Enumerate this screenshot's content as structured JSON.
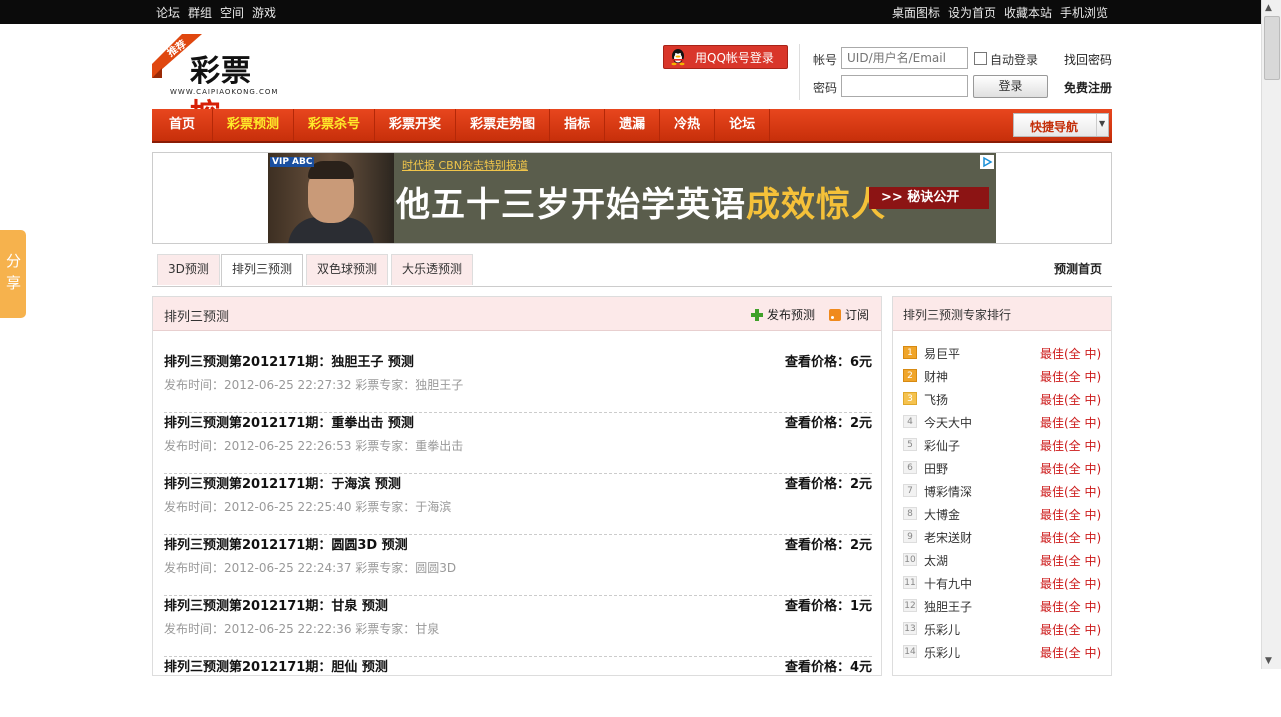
{
  "topbar": {
    "left": [
      "论坛",
      "群组",
      "空间",
      "游戏"
    ],
    "right": [
      "桌面图标",
      "设为首页",
      "收藏本站",
      "手机浏览"
    ]
  },
  "share": {
    "label": "分享"
  },
  "logo": {
    "tag": "推荐",
    "name1": "彩票",
    "name2": "控",
    "site": "WWW.CAIPIAOKONG.COM"
  },
  "login": {
    "qq_button": "用QQ帐号登录",
    "account_label": "帐号",
    "account_placeholder": "UID/用户名/Email",
    "auto_login": "自动登录",
    "find_password": "找回密码",
    "password_label": "密码",
    "login_button": "登录",
    "register": "免费注册"
  },
  "nav": {
    "items": [
      "首页",
      "彩票预测",
      "彩票杀号",
      "彩票开奖",
      "彩票走势图",
      "指标",
      "遗漏",
      "冷热",
      "论坛"
    ],
    "quick_nav": "快捷导航"
  },
  "ad": {
    "vip": "VIP ABC",
    "subtitle": "时代报 CBN杂志特别报道",
    "headline_a": "他五十三岁开始学英语",
    "headline_b": "成效惊人",
    "cta": ">> 秘诀公开"
  },
  "tabs": {
    "items": [
      "3D预测",
      "排列三预测",
      "双色球预测",
      "大乐透预测"
    ],
    "active": "排列三预测",
    "home": "预测首页"
  },
  "panel": {
    "title": "排列三预测",
    "publish": "发布预测",
    "subscribe": "订阅",
    "rows": [
      {
        "title": "排列三预测第2012171期：独胆王子 预测",
        "price": "查看价格：6元",
        "meta": "发布时间：2012-06-25 22:27:32 彩票专家：独胆王子"
      },
      {
        "title": "排列三预测第2012171期：重拳出击 预测",
        "price": "查看价格：2元",
        "meta": "发布时间：2012-06-25 22:26:53 彩票专家：重拳出击"
      },
      {
        "title": "排列三预测第2012171期：于海滨 预测",
        "price": "查看价格：2元",
        "meta": "发布时间：2012-06-25 22:25:40 彩票专家：于海滨"
      },
      {
        "title": "排列三预测第2012171期：圆圆3D 预测",
        "price": "查看价格：2元",
        "meta": "发布时间：2012-06-25 22:24:37 彩票专家：圆圆3D"
      },
      {
        "title": "排列三预测第2012171期：甘泉 预测",
        "price": "查看价格：1元",
        "meta": "发布时间：2012-06-25 22:22:36 彩票专家：甘泉"
      },
      {
        "title": "排列三预测第2012171期：胆仙 预测",
        "price": "查看价格：4元",
        "meta": ""
      }
    ]
  },
  "ranking": {
    "title": "排列三预测专家排行",
    "items": [
      {
        "num": "1",
        "name": "易巨平",
        "best": "最佳(全 中)"
      },
      {
        "num": "2",
        "name": "财神",
        "best": "最佳(全 中)"
      },
      {
        "num": "3",
        "name": "飞扬",
        "best": "最佳(全 中)"
      },
      {
        "num": "4",
        "name": "今天大中",
        "best": "最佳(全 中)"
      },
      {
        "num": "5",
        "name": "彩仙子",
        "best": "最佳(全 中)"
      },
      {
        "num": "6",
        "name": "田野",
        "best": "最佳(全 中)"
      },
      {
        "num": "7",
        "name": "博彩情深",
        "best": "最佳(全 中)"
      },
      {
        "num": "8",
        "name": "大博金",
        "best": "最佳(全 中)"
      },
      {
        "num": "9",
        "name": "老宋送财",
        "best": "最佳(全 中)"
      },
      {
        "num": "10",
        "name": "太湖",
        "best": "最佳(全 中)"
      },
      {
        "num": "11",
        "name": "十有九中",
        "best": "最佳(全 中)"
      },
      {
        "num": "12",
        "name": "独胆王子",
        "best": "最佳(全 中)"
      },
      {
        "num": "13",
        "name": "乐彩儿",
        "best": "最佳(全 中)"
      },
      {
        "num": "14",
        "name": "乐彩儿",
        "best": "最佳(全 中)"
      }
    ]
  }
}
